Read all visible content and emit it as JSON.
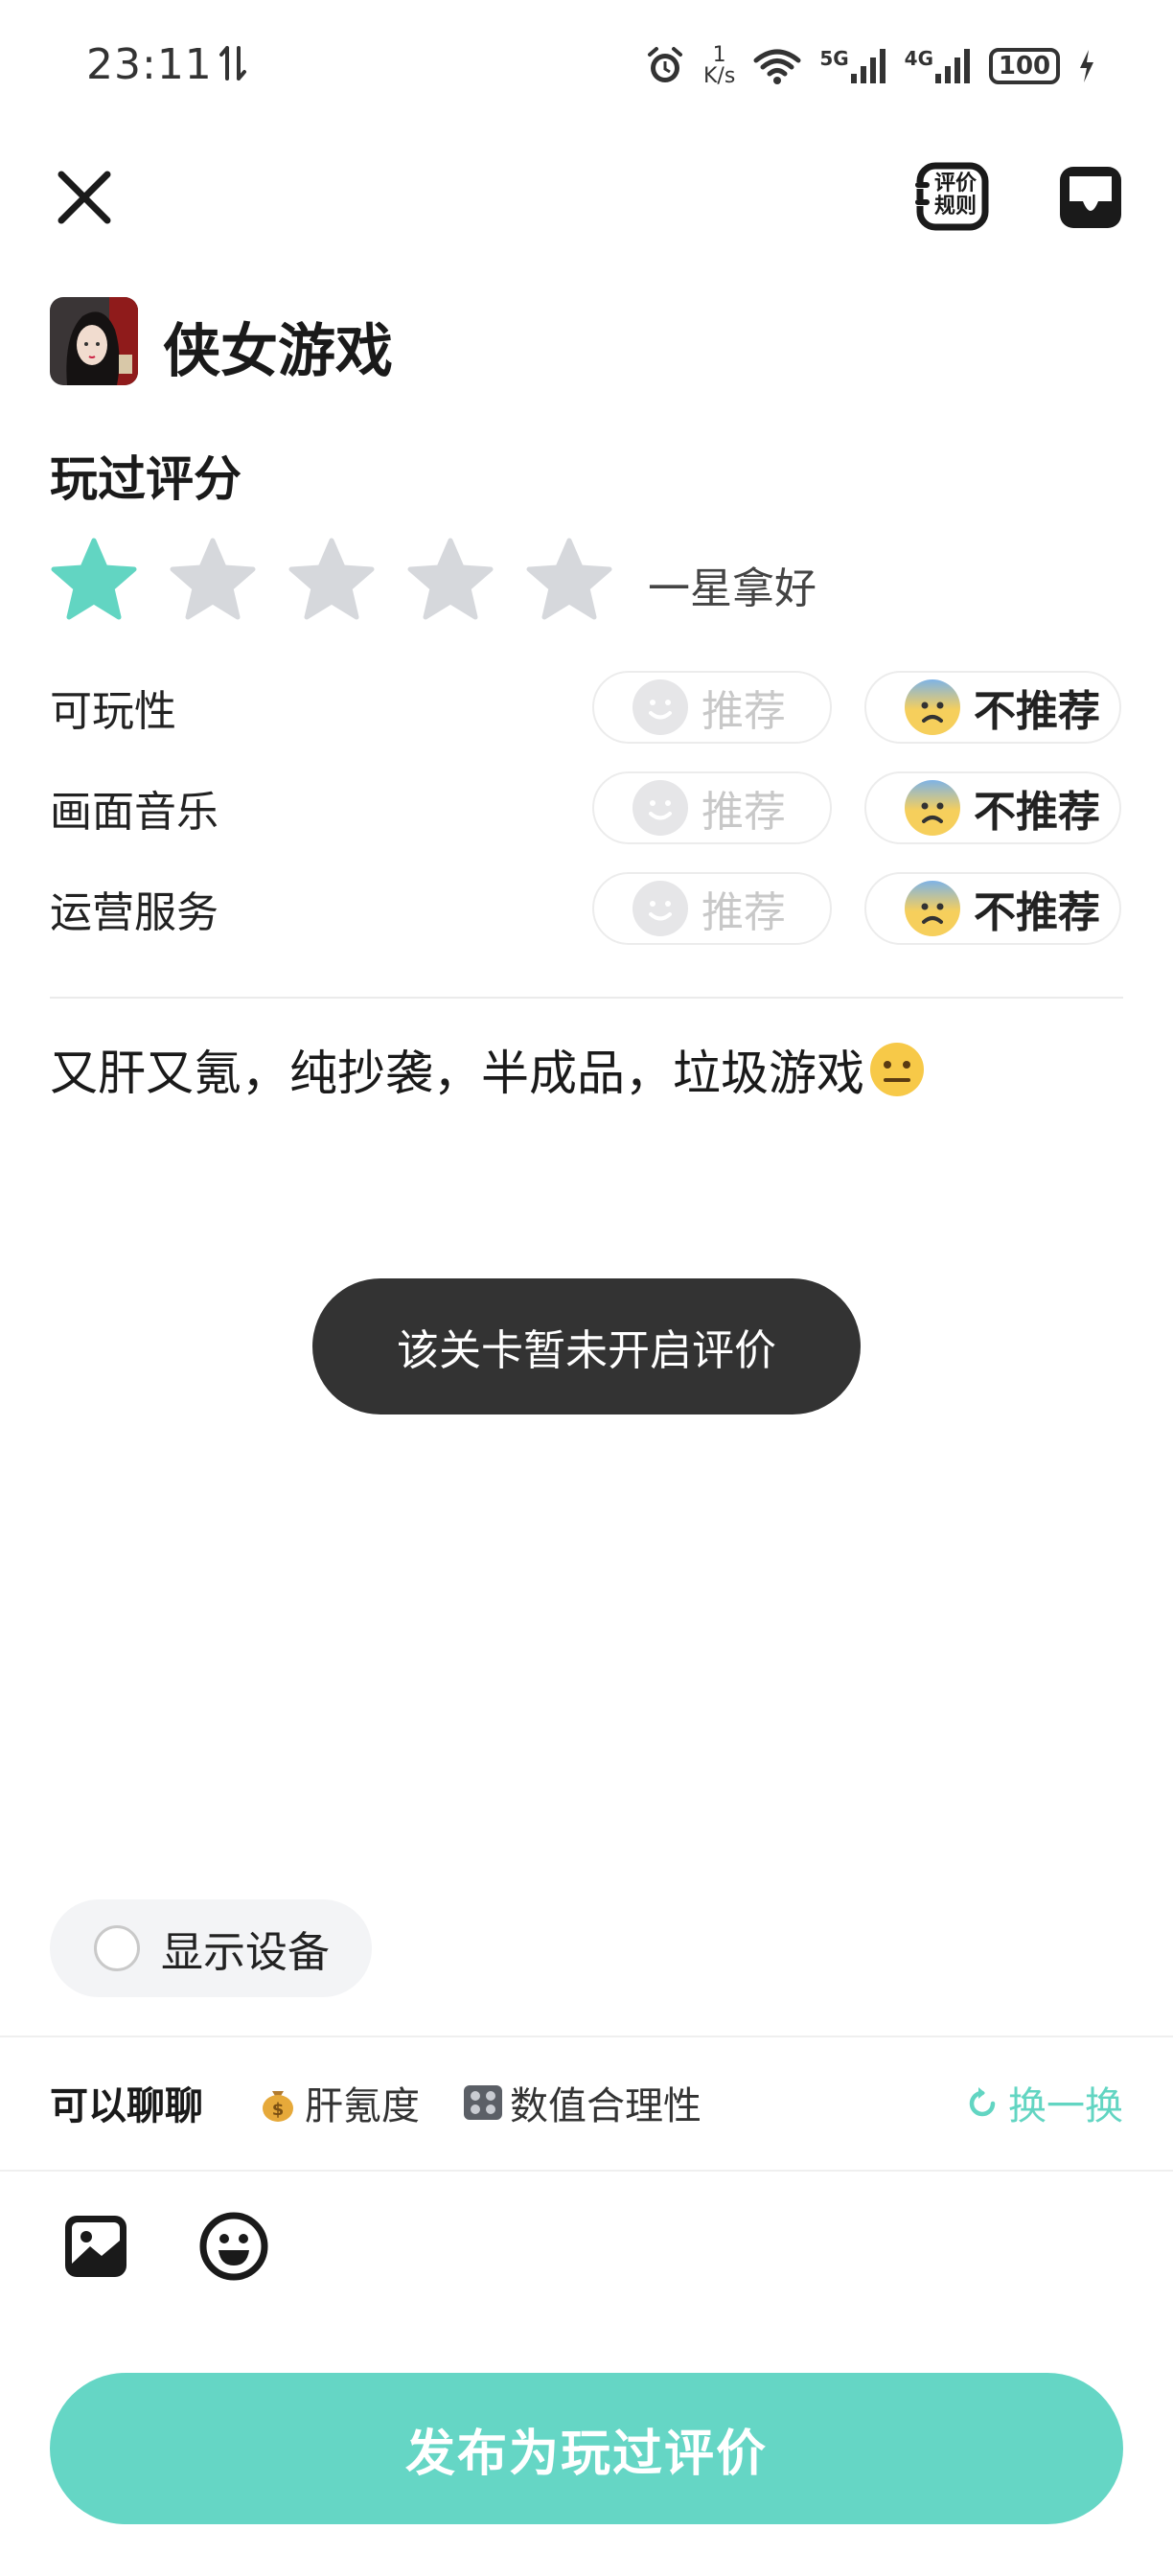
{
  "status_bar": {
    "time": "23:11",
    "net_speed_value": "1",
    "net_speed_unit": "K/s",
    "signal_5g": "5G",
    "signal_4g": "4G",
    "battery": "100"
  },
  "header": {
    "rules_label_line1": "评价",
    "rules_label_line2": "规则"
  },
  "game": {
    "name": "侠女游戏"
  },
  "rating": {
    "section_title": "玩过评分",
    "stars_selected": 1,
    "stars_total": 5,
    "star_label": "一星拿好",
    "accent_color": "#62d5c2",
    "inactive_color": "#d6d8dc",
    "rows": [
      {
        "label": "可玩性",
        "recommend": "推荐",
        "not_recommend": "不推荐",
        "selected": "not_recommend"
      },
      {
        "label": "画面音乐",
        "recommend": "推荐",
        "not_recommend": "不推荐",
        "selected": "not_recommend"
      },
      {
        "label": "运营服务",
        "recommend": "推荐",
        "not_recommend": "不推荐",
        "selected": "not_recommend"
      }
    ]
  },
  "review": {
    "text": "又肝又氪，纯抄袭，半成品，垃圾游戏",
    "trailing_emoji": "neutral-face"
  },
  "toast": {
    "message": "该关卡暂未开启评价"
  },
  "device": {
    "label": "显示设备",
    "checked": false
  },
  "topics": {
    "title": "可以聊聊",
    "items": [
      {
        "emoji": "money-bag-icon",
        "label": "肝氪度"
      },
      {
        "emoji": "control-knobs-icon",
        "label": "数值合理性"
      }
    ],
    "refresh_label": "换一换"
  },
  "publish": {
    "label": "发布为玩过评价",
    "color": "#65d6c5"
  }
}
